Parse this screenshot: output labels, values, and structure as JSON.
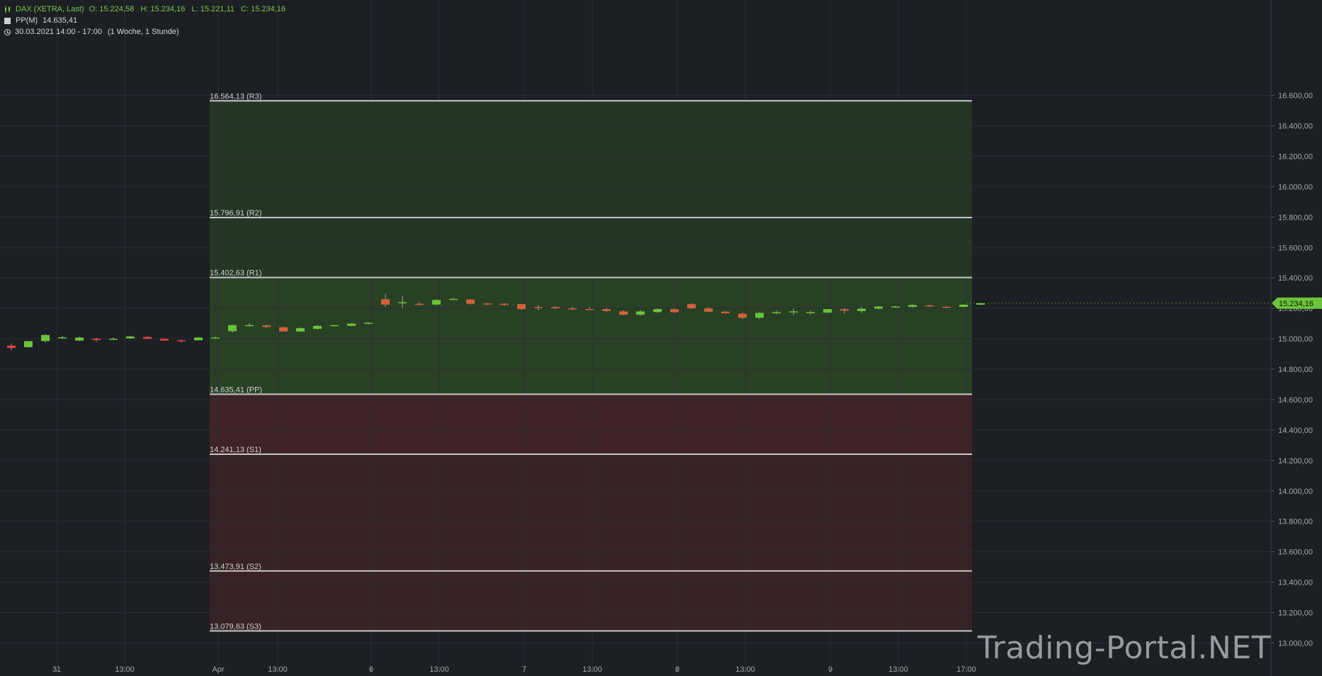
{
  "header": {
    "instrument": "DAX (XETRA, Last)",
    "ohlc": "O: 15.224,58   H: 15.234,16   L: 15.221,11   C: 15.234,16",
    "indicator_name": "PP(M)",
    "indicator_value": "14.635,41",
    "timerange": "30.03.2021 14:00 - 17:00",
    "timeframe": "(1 Woche, 1 Stunde)"
  },
  "watermark": "Trading-Portal.NET",
  "colors": {
    "background": "#1c1f24",
    "up": "#6cc43a",
    "down": "#d4603a",
    "down_bright": "#e8413d",
    "resistance_zone": "#2c4a24",
    "support_zone": "#4a2427",
    "level_line": "#c8c8c8",
    "last_price_badge": "#6cc43a"
  },
  "chart_data": {
    "type": "candlestick",
    "title": "DAX (XETRA, Last)",
    "ylim": [
      12900,
      16750
    ],
    "grid": true,
    "y_ticks": [
      13000,
      13200,
      13400,
      13600,
      13800,
      14000,
      14200,
      14400,
      14600,
      14800,
      15000,
      15200,
      15400,
      15600,
      15800,
      16000,
      16200,
      16400,
      16600
    ],
    "y_tick_labels": [
      "13.000,00",
      "13.200,00",
      "13.400,00",
      "13.600,00",
      "13.800,00",
      "14.000,00",
      "14.200,00",
      "14.400,00",
      "14.600,00",
      "14.800,00",
      "15.000,00",
      "15.200,00",
      "15.400,00",
      "15.600,00",
      "15.800,00",
      "16.000,00",
      "16.200,00",
      "16.400,00",
      "16.600,00"
    ],
    "x_tick_labels": [
      "31",
      "13:00",
      "Apr",
      "13:00",
      "6",
      "13:00",
      "7",
      "13:00",
      "8",
      "13:00",
      "9",
      "13:00",
      "17:00"
    ],
    "x_tick_bars": [
      3,
      7,
      12.5,
      16,
      21.5,
      25.5,
      30.5,
      34.5,
      39.5,
      43.5,
      48.5,
      52.5,
      56.5
    ],
    "last_price": 15234.16,
    "last_price_label": "15.234,16",
    "pivot_levels": [
      {
        "label": "16.564,13 (R3)",
        "value": 16564.13
      },
      {
        "label": "15.796,91 (R2)",
        "value": 15796.91
      },
      {
        "label": "15.402,63 (R1)",
        "value": 15402.63
      },
      {
        "label": "14.635,41 (PP)",
        "value": 14635.41
      },
      {
        "label": "14.241,13 (S1)",
        "value": 14241.13
      },
      {
        "label": "13.473,91 (S2)",
        "value": 13473.91
      },
      {
        "label": "13.079,63 (S3)",
        "value": 13079.63
      }
    ],
    "pivot_start_bar": 12,
    "pivot_end_bar": 56.5,
    "candles": [
      {
        "o": 14955,
        "h": 14970,
        "l": 14925,
        "c": 14940
      },
      {
        "o": 14945,
        "h": 14975,
        "l": 14940,
        "c": 14985
      },
      {
        "o": 14985,
        "h": 15030,
        "l": 14975,
        "c": 15025
      },
      {
        "o": 15005,
        "h": 15020,
        "l": 15000,
        "c": 15010
      },
      {
        "o": 14988,
        "h": 15015,
        "l": 14985,
        "c": 15008
      },
      {
        "o": 15000,
        "h": 15008,
        "l": 14980,
        "c": 14992
      },
      {
        "o": 14997,
        "h": 15010,
        "l": 14992,
        "c": 15000
      },
      {
        "o": 15003,
        "h": 15020,
        "l": 15000,
        "c": 15015
      },
      {
        "o": 15012,
        "h": 15018,
        "l": 14998,
        "c": 15000
      },
      {
        "o": 15000,
        "h": 15003,
        "l": 14988,
        "c": 14988
      },
      {
        "o": 14990,
        "h": 14995,
        "l": 14975,
        "c": 14985
      },
      {
        "o": 14990,
        "h": 15012,
        "l": 14990,
        "c": 15008
      },
      {
        "o": 15005,
        "h": 15015,
        "l": 15000,
        "c": 15008
      },
      {
        "o": 15050,
        "h": 15095,
        "l": 15040,
        "c": 15090
      },
      {
        "o": 15088,
        "h": 15100,
        "l": 15080,
        "c": 15090
      },
      {
        "o": 15088,
        "h": 15093,
        "l": 15070,
        "c": 15078
      },
      {
        "o": 15075,
        "h": 15080,
        "l": 15048,
        "c": 15048
      },
      {
        "o": 15048,
        "h": 15075,
        "l": 15045,
        "c": 15070
      },
      {
        "o": 15065,
        "h": 15090,
        "l": 15060,
        "c": 15085
      },
      {
        "o": 15085,
        "h": 15092,
        "l": 15080,
        "c": 15090
      },
      {
        "o": 15085,
        "h": 15105,
        "l": 15080,
        "c": 15100
      },
      {
        "o": 15100,
        "h": 15110,
        "l": 15095,
        "c": 15105
      },
      {
        "o": 15260,
        "h": 15295,
        "l": 15210,
        "c": 15225
      },
      {
        "o": 15240,
        "h": 15280,
        "l": 15200,
        "c": 15240
      },
      {
        "o": 15230,
        "h": 15240,
        "l": 15220,
        "c": 15225
      },
      {
        "o": 15225,
        "h": 15260,
        "l": 15220,
        "c": 15255
      },
      {
        "o": 15258,
        "h": 15270,
        "l": 15255,
        "c": 15262
      },
      {
        "o": 15258,
        "h": 15262,
        "l": 15225,
        "c": 15230
      },
      {
        "o": 15232,
        "h": 15238,
        "l": 15220,
        "c": 15228
      },
      {
        "o": 15230,
        "h": 15235,
        "l": 15215,
        "c": 15225
      },
      {
        "o": 15228,
        "h": 15230,
        "l": 15192,
        "c": 15195
      },
      {
        "o": 15208,
        "h": 15222,
        "l": 15188,
        "c": 15205
      },
      {
        "o": 15208,
        "h": 15215,
        "l": 15195,
        "c": 15200
      },
      {
        "o": 15200,
        "h": 15210,
        "l": 15188,
        "c": 15193
      },
      {
        "o": 15196,
        "h": 15210,
        "l": 15190,
        "c": 15195
      },
      {
        "o": 15195,
        "h": 15200,
        "l": 15178,
        "c": 15183
      },
      {
        "o": 15180,
        "h": 15188,
        "l": 15155,
        "c": 15158
      },
      {
        "o": 15158,
        "h": 15190,
        "l": 15150,
        "c": 15180
      },
      {
        "o": 15176,
        "h": 15200,
        "l": 15170,
        "c": 15195
      },
      {
        "o": 15195,
        "h": 15200,
        "l": 15170,
        "c": 15175
      },
      {
        "o": 15228,
        "h": 15235,
        "l": 15195,
        "c": 15200
      },
      {
        "o": 15200,
        "h": 15210,
        "l": 15175,
        "c": 15178
      },
      {
        "o": 15178,
        "h": 15183,
        "l": 15165,
        "c": 15168
      },
      {
        "o": 15165,
        "h": 15172,
        "l": 15130,
        "c": 15138
      },
      {
        "o": 15138,
        "h": 15175,
        "l": 15130,
        "c": 15170
      },
      {
        "o": 15168,
        "h": 15185,
        "l": 15160,
        "c": 15175
      },
      {
        "o": 15178,
        "h": 15200,
        "l": 15155,
        "c": 15180
      },
      {
        "o": 15175,
        "h": 15185,
        "l": 15160,
        "c": 15175
      },
      {
        "o": 15172,
        "h": 15195,
        "l": 15170,
        "c": 15195
      },
      {
        "o": 15195,
        "h": 15203,
        "l": 15165,
        "c": 15185
      },
      {
        "o": 15182,
        "h": 15210,
        "l": 15170,
        "c": 15198
      },
      {
        "o": 15198,
        "h": 15215,
        "l": 15192,
        "c": 15212
      },
      {
        "o": 15210,
        "h": 15218,
        "l": 15205,
        "c": 15212
      },
      {
        "o": 15210,
        "h": 15225,
        "l": 15205,
        "c": 15222
      },
      {
        "o": 15220,
        "h": 15225,
        "l": 15208,
        "c": 15213
      },
      {
        "o": 15210,
        "h": 15212,
        "l": 15200,
        "c": 15206
      },
      {
        "o": 15210,
        "h": 15228,
        "l": 15206,
        "c": 15224
      },
      {
        "o": 15224,
        "h": 15234,
        "l": 15221,
        "c": 15234
      }
    ]
  }
}
